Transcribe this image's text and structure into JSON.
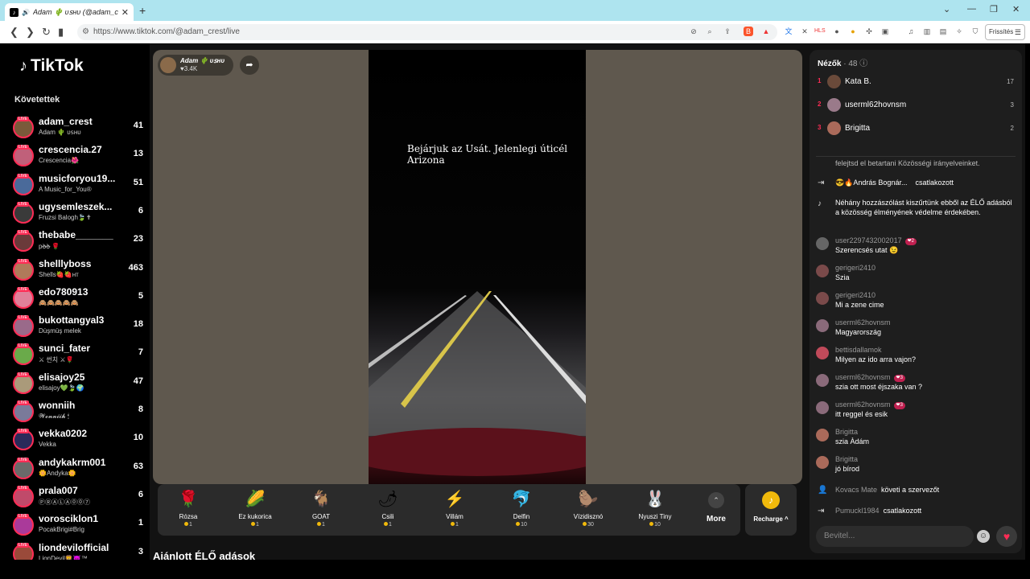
{
  "browser": {
    "tab_title": "Adam 🌵 ᴜꜱʜᴜ (@adam_crest",
    "url": "https://www.tiktok.com/@adam_crest/live",
    "update_button": "Frissítés"
  },
  "sidebar": {
    "logo": "TikTok",
    "following_title": "Követettek",
    "items": [
      {
        "name": "adam_crest",
        "sub": "Adam 🌵 ᴜꜱʜᴜ",
        "count": "41"
      },
      {
        "name": "crescencia.27",
        "sub": "Crescencia🌺",
        "count": "13"
      },
      {
        "name": "musicforyou19...",
        "sub": "A Music_for_You®",
        "count": "51"
      },
      {
        "name": "ugysemleszek...",
        "sub": "Fruzsi Balogh🍃✝",
        "count": "6"
      },
      {
        "name": "thebabe_______",
        "sub": "pꝺ̶ꝺ̶ 🌹",
        "count": "23"
      },
      {
        "name": "shelllyboss",
        "sub": "Shells🍓🍓ʜᴛ",
        "count": "463"
      },
      {
        "name": "edo780913",
        "sub": "🙈🙈🙈🙈🙈",
        "count": "5"
      },
      {
        "name": "bukottangyal3",
        "sub": "Dùşmüş melek",
        "count": "18"
      },
      {
        "name": "sunci_fater",
        "sub": "⚔ 썬치 ⚔🌹",
        "count": "7"
      },
      {
        "name": "elisajoy25",
        "sub": "elisajoy💚🍃🌍",
        "count": "47"
      },
      {
        "name": "wonniih",
        "sub": "𝓦𝓸𝓷𝓷𝓲𝓲𝓱 🕯",
        "count": "8"
      },
      {
        "name": "vekka0202",
        "sub": "Vekka",
        "count": "10"
      },
      {
        "name": "andykakrm001",
        "sub": "🌼Andyka🌼",
        "count": "63"
      },
      {
        "name": "prala007",
        "sub": "ⓅⓇⒶⓁⒶ⓪⓪⑦",
        "count": "6"
      },
      {
        "name": "vorosciklon1",
        "sub": "PocakBrigi#Brig",
        "count": "1"
      },
      {
        "name": "liondevilofficial",
        "sub": "LionDevil🦁😈™",
        "count": "3"
      }
    ]
  },
  "stream": {
    "host_name": "Adam 🌵 ᴜꜱʜᴜ",
    "host_likes": "♥3.4K",
    "overlay_text": "Bejárjuk az Usát. Jelenlegi úticél Arizona"
  },
  "gifts": [
    {
      "name": "Rózsa",
      "price": "1",
      "icon": "rose-icon",
      "glyph": "🌹"
    },
    {
      "name": "Ez kukorica",
      "price": "1",
      "icon": "corn-icon",
      "glyph": "🌽"
    },
    {
      "name": "GOAT",
      "price": "1",
      "icon": "goat-icon",
      "glyph": "🐐"
    },
    {
      "name": "Csili",
      "price": "1",
      "icon": "chili-icon",
      "glyph": "🌶"
    },
    {
      "name": "Villám",
      "price": "1",
      "icon": "lightning-icon",
      "glyph": "⚡"
    },
    {
      "name": "Delfin",
      "price": "10",
      "icon": "dolphin-icon",
      "glyph": "🐬"
    },
    {
      "name": "Vízidisznó",
      "price": "30",
      "icon": "capybara-icon",
      "glyph": "🦫"
    },
    {
      "name": "Nyuszi Tiny",
      "price": "10",
      "icon": "bunny-icon",
      "glyph": "🐰"
    }
  ],
  "gift_more": "More",
  "recharge_label": "Recharge ^",
  "recommended_title": "Ajánlott ÉLŐ adások",
  "chat": {
    "viewers_label": "Nézők",
    "viewers_count": "· 48",
    "top_viewers": [
      {
        "rank": "1",
        "name": "Kata B.",
        "count": "17"
      },
      {
        "rank": "2",
        "name": "userml62hovnsm",
        "count": "3"
      },
      {
        "rank": "3",
        "name": "Brigitta",
        "count": "2"
      }
    ],
    "rules_text": "felejtsd el betartani Közösségi irányelveinket.",
    "joined_1_user": "😎🔥András Bognár...",
    "joined_1_action": "csatlakozott",
    "system_notice": "Néhány hozzászólást kiszűrtünk ebből az ÉLŐ adásból a közösség élményének védelme érdekében.",
    "messages": [
      {
        "user": "user2297432002017",
        "badge": "2",
        "text": "Szerencsés utat 😉"
      },
      {
        "user": "gerigeri2410",
        "badge": "",
        "text": "Szia"
      },
      {
        "user": "gerigeri2410",
        "badge": "",
        "text": "Mi a zene cime"
      },
      {
        "user": "userml62hovnsm",
        "badge": "",
        "text": "Magyarország"
      },
      {
        "user": "bettisdallamok",
        "badge": "",
        "text": "Milyen az ido arra vajon?"
      },
      {
        "user": "userml62hovnsm",
        "badge": "3",
        "text": "szia ott most éjszaka van ?"
      },
      {
        "user": "userml62hovnsm",
        "badge": "3",
        "text": "itt reggel és esik"
      },
      {
        "user": "Brigitta",
        "badge": "",
        "text": "szia Àdám"
      },
      {
        "user": "Brigitta",
        "badge": "",
        "text": "jó bírod"
      }
    ],
    "follow_user": "Kovacs Mate",
    "follow_action": "követi a szervezőt",
    "joined_2_user": "Pumuckl1984",
    "joined_2_action": "csatlakozott",
    "input_placeholder": "Bevitel..."
  }
}
